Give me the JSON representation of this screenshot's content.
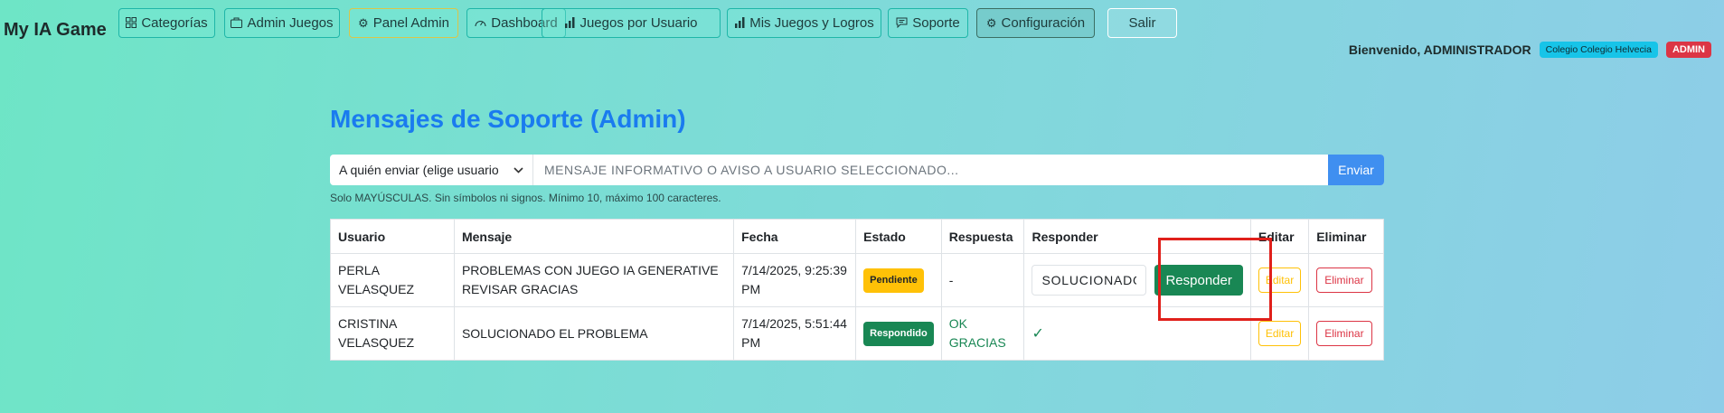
{
  "app": {
    "brand": "My IA Game"
  },
  "nav": {
    "categorias": "Categorías",
    "admin_juegos": "Admin Juegos",
    "panel_admin": "Panel Admin",
    "dashboard": "Dashboard",
    "juegos_usuario": "Juegos por Usuario",
    "mis_juegos": "Mis Juegos y Logros",
    "soporte": "Soporte",
    "configuracion": "Configuración",
    "salir": "Salir"
  },
  "user": {
    "welcome": "Bienvenido, ADMINISTRADOR",
    "school_badge": "Colegio Colegio Helvecia",
    "role_badge": "ADMIN"
  },
  "page": {
    "title": "Mensajes de Soporte (Admin)",
    "recipient_select": "A quién enviar (elige usuario",
    "message_placeholder": "MENSAJE INFORMATIVO O AVISO A USUARIO SELECCIONADO...",
    "send_label": "Enviar",
    "hint": "Solo MAYÚSCULAS. Sin símbolos ni signos. Mínimo 10, máximo 100 caracteres."
  },
  "table": {
    "headers": {
      "usuario": "Usuario",
      "mensaje": "Mensaje",
      "fecha": "Fecha",
      "estado": "Estado",
      "respuesta": "Respuesta",
      "responder": "Responder",
      "editar": "Editar",
      "eliminar": "Eliminar"
    },
    "rows": [
      {
        "usuario": "PERLA VELASQUEZ",
        "mensaje": "PROBLEMAS CON JUEGO IA GENERATIVE REVISAR GRACIAS",
        "fecha": "7/14/2025, 9:25:39 PM",
        "estado": "Pendiente",
        "respuesta": "-",
        "reply_value": "SOLUCIONADO",
        "reply_button": "Responder",
        "edit": "Editar",
        "delete": "Eliminar"
      },
      {
        "usuario": "CRISTINA VELASQUEZ",
        "mensaje": "SOLUCIONADO EL PROBLEMA",
        "fecha": "7/14/2025, 5:51:44 PM",
        "estado": "Respondido",
        "respuesta": "OK GRACIAS",
        "responder_mark": "✓",
        "edit": "Editar",
        "delete": "Eliminar"
      }
    ]
  },
  "colors": {
    "accent_title": "#1a7bef",
    "success": "#198754",
    "warning": "#ffc107",
    "danger": "#dc3545",
    "info": "#17c4e8",
    "highlight_box": "#e0201b"
  },
  "icons": {
    "categorias": "grid-icon",
    "admin_juegos": "briefcase-icon",
    "panel_admin": "gear-icon",
    "dashboard": "speedometer-icon",
    "juegos_usuario": "bar-chart-icon",
    "mis_juegos": "bar-chart-icon",
    "soporte": "chat-icon",
    "configuracion": "gear-icon",
    "select": "chevron-down-icon"
  }
}
